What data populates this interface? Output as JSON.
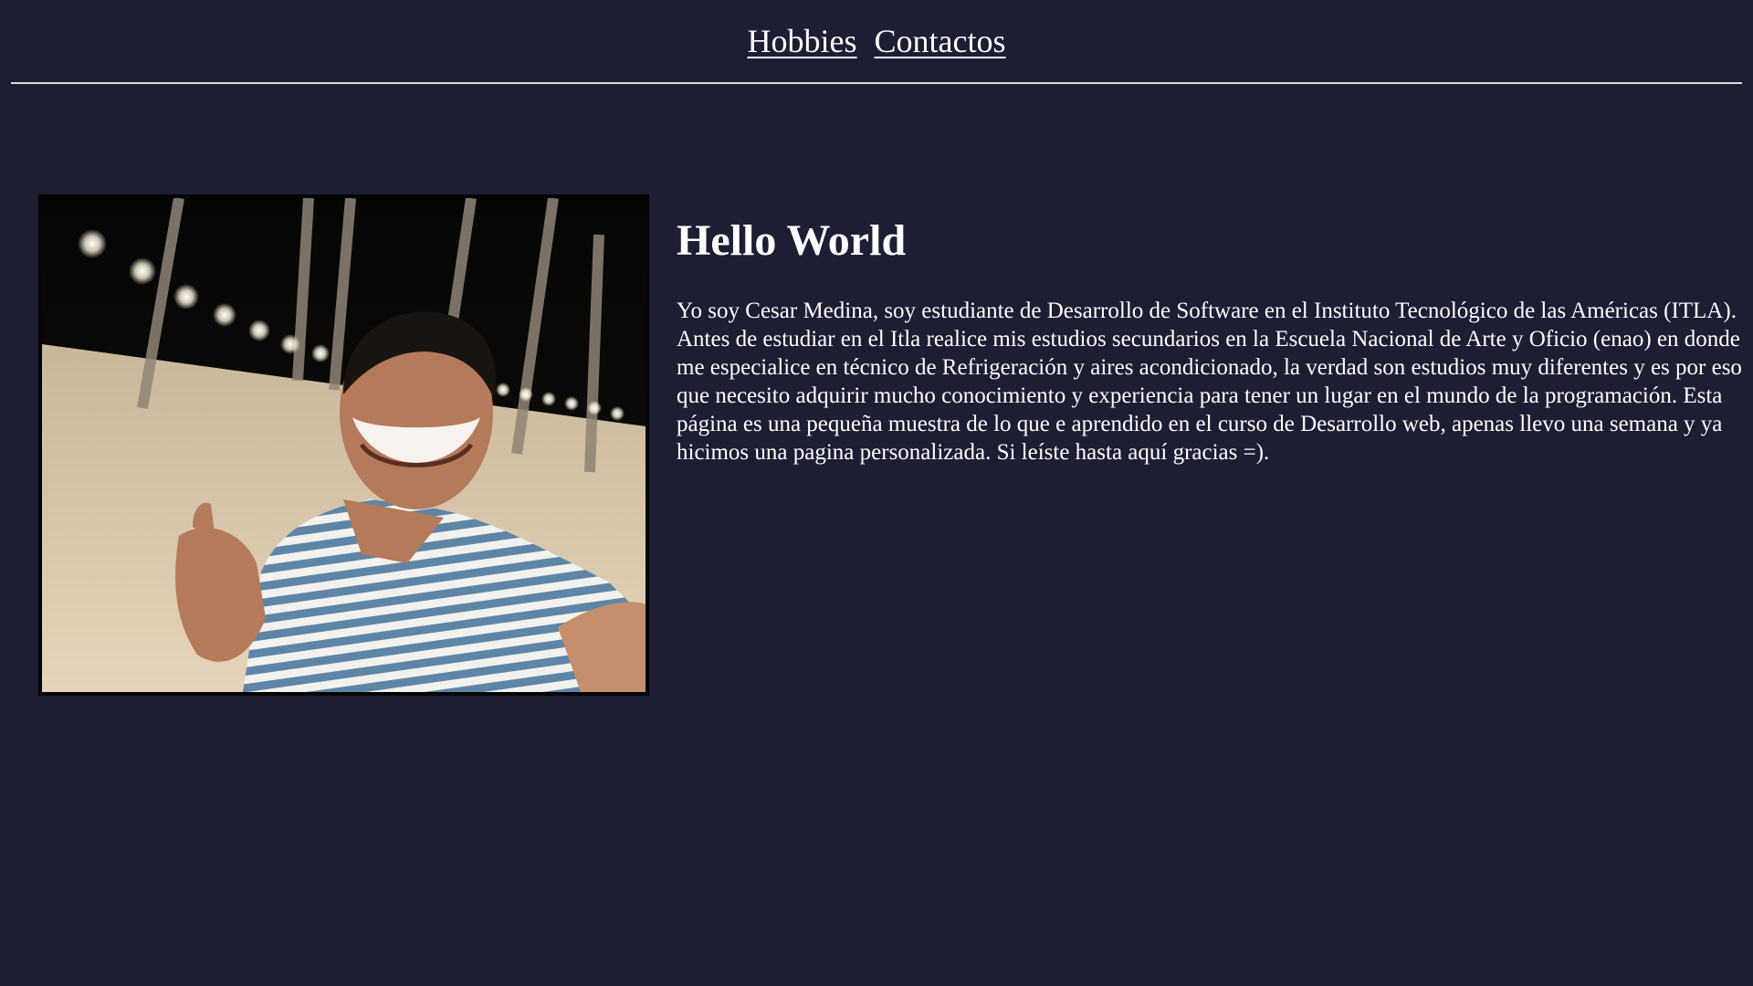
{
  "nav": {
    "links": [
      {
        "label": "Hobbies"
      },
      {
        "label": "Contactos"
      }
    ]
  },
  "main": {
    "title": "Hello World",
    "bio": "Yo soy Cesar Medina, soy estudiante de Desarrollo de Software en el Instituto Tecnológico de las Américas (ITLA). Antes de estudiar en el Itla realice mis estudios secundarios en la Escuela Nacional de Arte y Oficio (enao) en donde me especialice en técnico de Refrigeración y aires acondicionado, la verdad son estudios muy diferentes y es por eso que necesito adquirir mucho conocimiento y experiencia para tener un lugar en el mundo de la programación. Esta página es una pequeña muestra de lo que e aprendido en el curso de Desarrollo web, apenas llevo una semana y ya hicimos una pagina personalizada. Si leíste hasta aquí gracias =)."
  },
  "colors": {
    "background": "#1d1e34",
    "text": "#ffffff",
    "divider": "#d8d8de",
    "photo_border": "#050505"
  }
}
